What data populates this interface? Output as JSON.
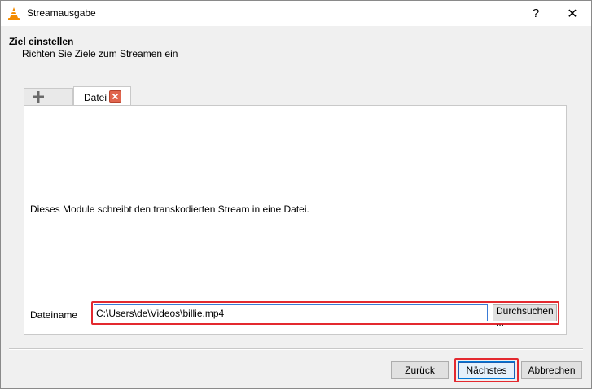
{
  "window": {
    "title": "Streamausgabe",
    "help_label": "?",
    "close_label": "✕"
  },
  "header": {
    "title": "Ziel einstellen",
    "subtitle": "Richten Sie Ziele zum Streamen ein"
  },
  "tabs": [
    {
      "label": "",
      "icon": "plus-icon"
    },
    {
      "label": "Datei",
      "icon": "close-icon"
    }
  ],
  "panel": {
    "description": "Dieses Module schreibt den transkodierten Stream in eine Datei.",
    "filename_label": "Dateiname",
    "filename_value": "C:\\Users\\de\\Videos\\billie.mp4",
    "browse_label": "Durchsuchen ..."
  },
  "buttons": {
    "back": "Zurück",
    "next": "Nächstes",
    "cancel": "Abbrechen"
  },
  "colors": {
    "highlight": "#e3292f",
    "accent": "#0078d7",
    "vlc_orange": "#f48b00"
  }
}
